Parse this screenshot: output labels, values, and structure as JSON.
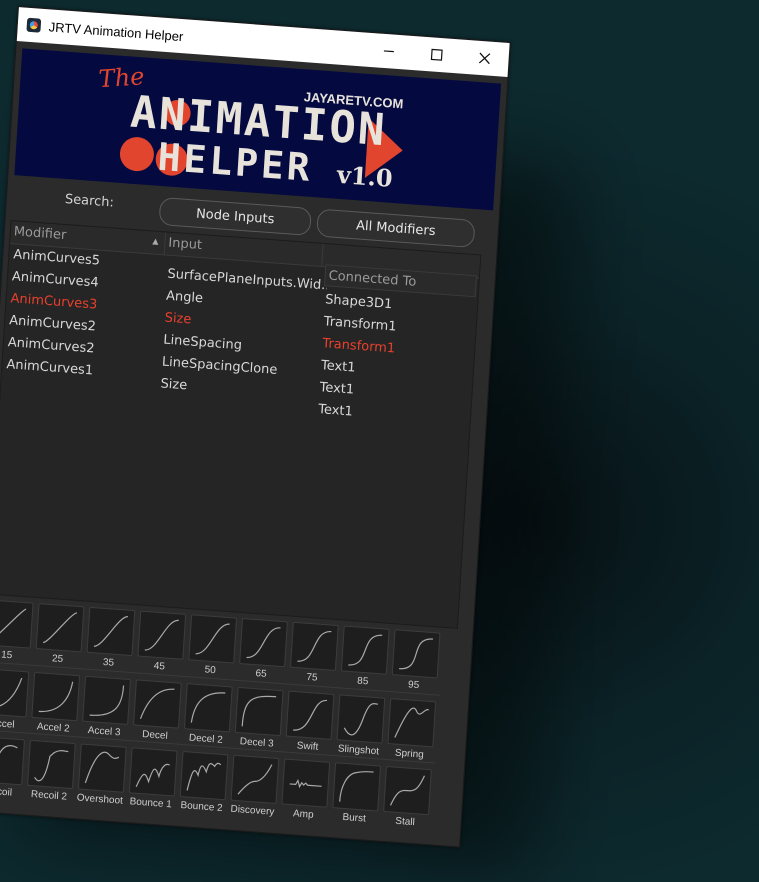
{
  "window": {
    "title": "JRTV Animation Helper"
  },
  "banner": {
    "the_text": "The",
    "line1": "ANIMATION",
    "line2": "HELPER",
    "site": "JAYARETV.COM",
    "version": "v1.0",
    "colors": {
      "background": "#040a40",
      "accent": "#e2452e",
      "text": "#e7e3da"
    }
  },
  "search": {
    "label": "Search:"
  },
  "buttons": {
    "node_inputs": "Node Inputs",
    "all_modifiers": "All Modifiers"
  },
  "tree": {
    "headers": {
      "modifier": "Modifier",
      "input": "Input",
      "connected_to": "Connected To"
    },
    "modifiers": [
      {
        "text": "AnimCurves5",
        "highlight": false
      },
      {
        "text": "AnimCurves4",
        "highlight": false
      },
      {
        "text": "AnimCurves3",
        "highlight": true
      },
      {
        "text": "AnimCurves2",
        "highlight": false
      },
      {
        "text": "AnimCurves2",
        "highlight": false
      },
      {
        "text": "AnimCurves1",
        "highlight": false
      }
    ],
    "inputs": [
      {
        "text": "SurfacePlaneInputs.Wid...",
        "highlight": false
      },
      {
        "text": "Angle",
        "highlight": false
      },
      {
        "text": "Size",
        "highlight": true
      },
      {
        "text": "LineSpacing",
        "highlight": false
      },
      {
        "text": "LineSpacingClone",
        "highlight": false
      },
      {
        "text": "Size",
        "highlight": false
      }
    ],
    "connected": [
      {
        "text": "Shape3D1",
        "highlight": false
      },
      {
        "text": "Transform1",
        "highlight": false
      },
      {
        "text": "Transform1",
        "highlight": true
      },
      {
        "text": "Text1",
        "highlight": false
      },
      {
        "text": "Text1",
        "highlight": false
      },
      {
        "text": "Text1",
        "highlight": false
      }
    ],
    "highlight_color": "#e8412d"
  },
  "presets": {
    "row1": [
      {
        "label": "15",
        "curve": "s15"
      },
      {
        "label": "25",
        "curve": "s25"
      },
      {
        "label": "35",
        "curve": "s35"
      },
      {
        "label": "45",
        "curve": "s45"
      },
      {
        "label": "50",
        "curve": "s50"
      },
      {
        "label": "65",
        "curve": "s65"
      },
      {
        "label": "75",
        "curve": "s75"
      },
      {
        "label": "85",
        "curve": "s85"
      },
      {
        "label": "95",
        "curve": "s95"
      }
    ],
    "row2": [
      {
        "label": "Accel",
        "curve": "accel"
      },
      {
        "label": "Accel 2",
        "curve": "accel2"
      },
      {
        "label": "Accel 3",
        "curve": "accel3"
      },
      {
        "label": "Decel",
        "curve": "decel"
      },
      {
        "label": "Decel 2",
        "curve": "decel2"
      },
      {
        "label": "Decel 3",
        "curve": "decel3"
      },
      {
        "label": "Swift",
        "curve": "swift"
      },
      {
        "label": "Slingshot",
        "curve": "slingshot"
      },
      {
        "label": "Spring",
        "curve": "spring"
      }
    ],
    "row3": [
      {
        "label": "Recoil",
        "curve": "recoil"
      },
      {
        "label": "Recoil 2",
        "curve": "recoil2"
      },
      {
        "label": "Overshoot",
        "curve": "overshoot"
      },
      {
        "label": "Bounce 1",
        "curve": "bounce1"
      },
      {
        "label": "Bounce 2",
        "curve": "bounce2"
      },
      {
        "label": "Discovery",
        "curve": "discovery"
      },
      {
        "label": "Amp",
        "curve": "amp"
      },
      {
        "label": "Burst",
        "curve": "burst"
      },
      {
        "label": "Stall",
        "curve": "stall"
      }
    ]
  }
}
